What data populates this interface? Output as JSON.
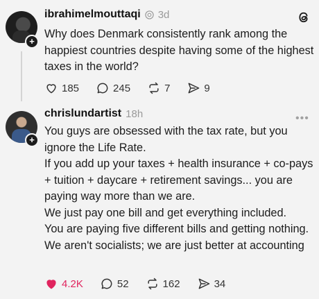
{
  "post1": {
    "username": "ibrahimelmouttaqi",
    "time": "3d",
    "text": "Why does Denmark consistently rank among the happiest countries despite having some of the highest taxes in the world?",
    "likes": "185",
    "comments": "245",
    "reposts": "7",
    "shares": "9"
  },
  "post2": {
    "username": "chrislundartist",
    "time": "18h",
    "paragraphs": [
      "You guys are obsessed with the tax rate, but you ignore the Life Rate.",
      "If you add up your taxes + health insurance + co-pays + tuition + daycare + retirement savings... you are paying way more than we are.",
      "We just pay one bill and get everything included.",
      "You are paying five different bills and getting nothing.",
      "We aren't socialists; we are just better at accounting"
    ],
    "likes": "4.2K",
    "comments": "52",
    "reposts": "162",
    "shares": "34"
  },
  "colors": {
    "like": "#e0245e",
    "muted": "#9a9a9a",
    "background": "#f3f3f3"
  },
  "icons": [
    "threads-logo-icon",
    "verified-icon",
    "heart-icon",
    "comment-icon",
    "repost-icon",
    "share-icon",
    "more-icon",
    "follow-plus-icon"
  ]
}
